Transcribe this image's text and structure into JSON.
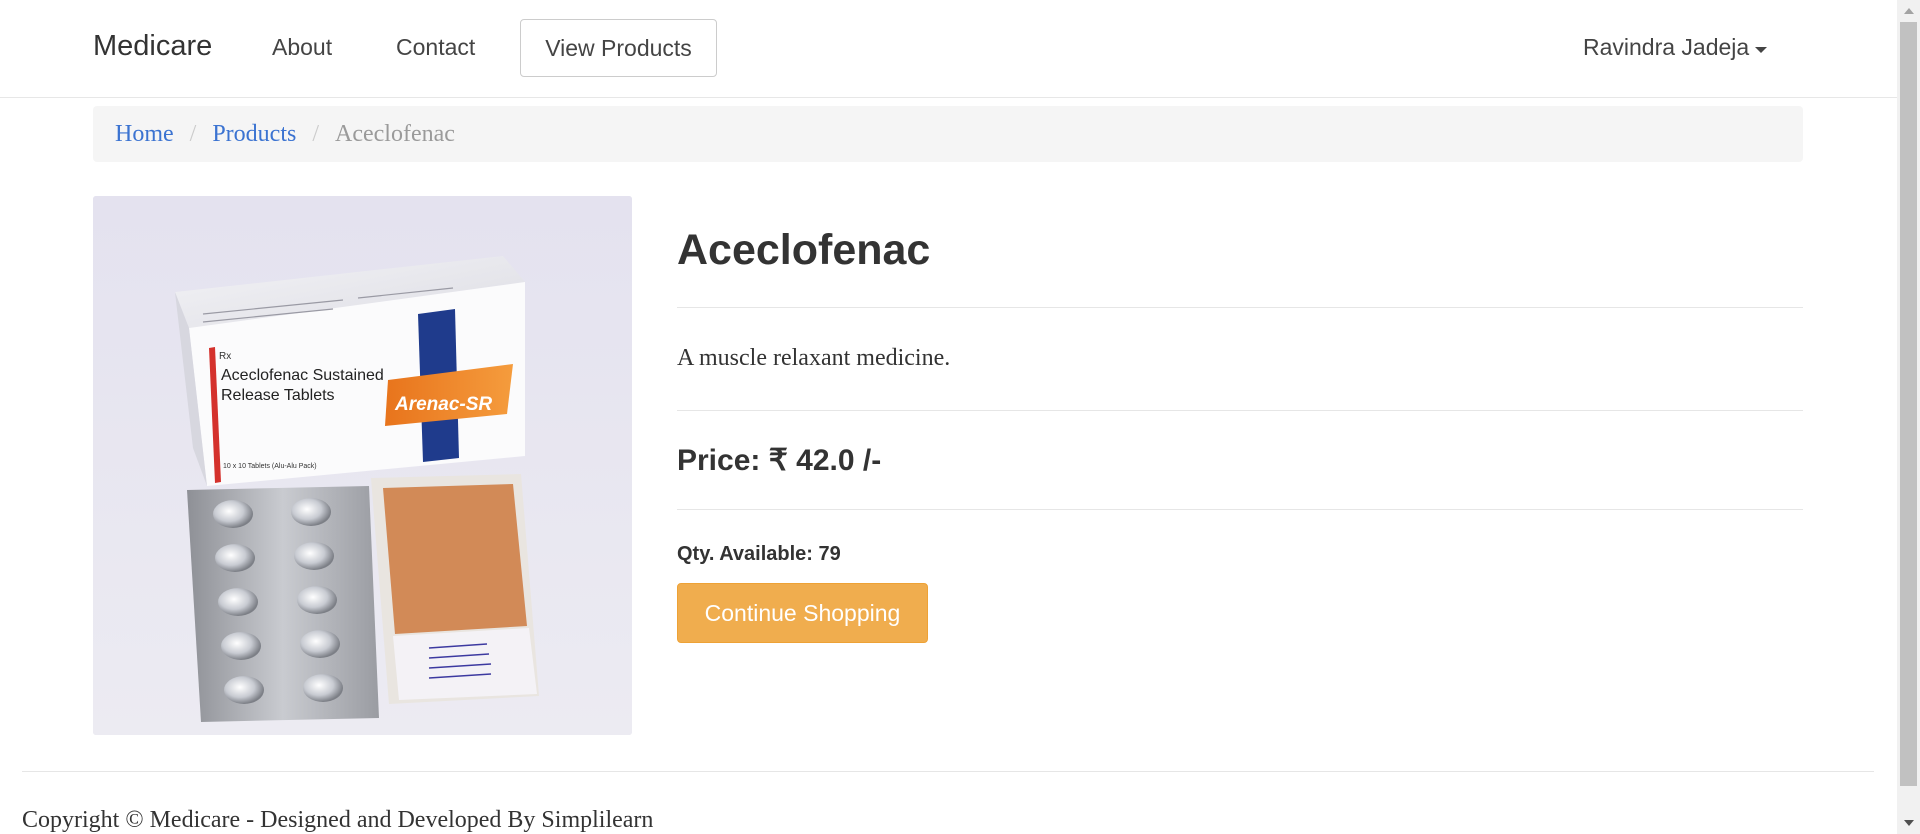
{
  "navbar": {
    "brand": "Medicare",
    "links": [
      "About",
      "Contact"
    ],
    "view_products": "View Products",
    "user_name": "Ravindra Jadeja"
  },
  "breadcrumb": {
    "home": "Home",
    "products": "Products",
    "current": "Aceclofenac"
  },
  "product": {
    "name": "Aceclofenac",
    "description": "A muscle relaxant medicine.",
    "price": "Price: ₹ 42.0 /-",
    "qty": "Qty. Available: 79",
    "image": {
      "box_line1": "Aceclofenac Sustained",
      "box_line2": "Release Tablets",
      "brand_label": "Arenac-SR",
      "pack_text": "10 x 10 Tablets (Alu-Alu Pack)",
      "rx": "Rx"
    }
  },
  "actions": {
    "continue_shopping": "Continue Shopping"
  },
  "footer": {
    "copyright": "Copyright © Medicare - Designed and Developed By Simplilearn"
  },
  "colors": {
    "link": "#3b73d1",
    "warning_button": "#f0ad4e",
    "breadcrumb_bg": "#f5f5f5"
  }
}
